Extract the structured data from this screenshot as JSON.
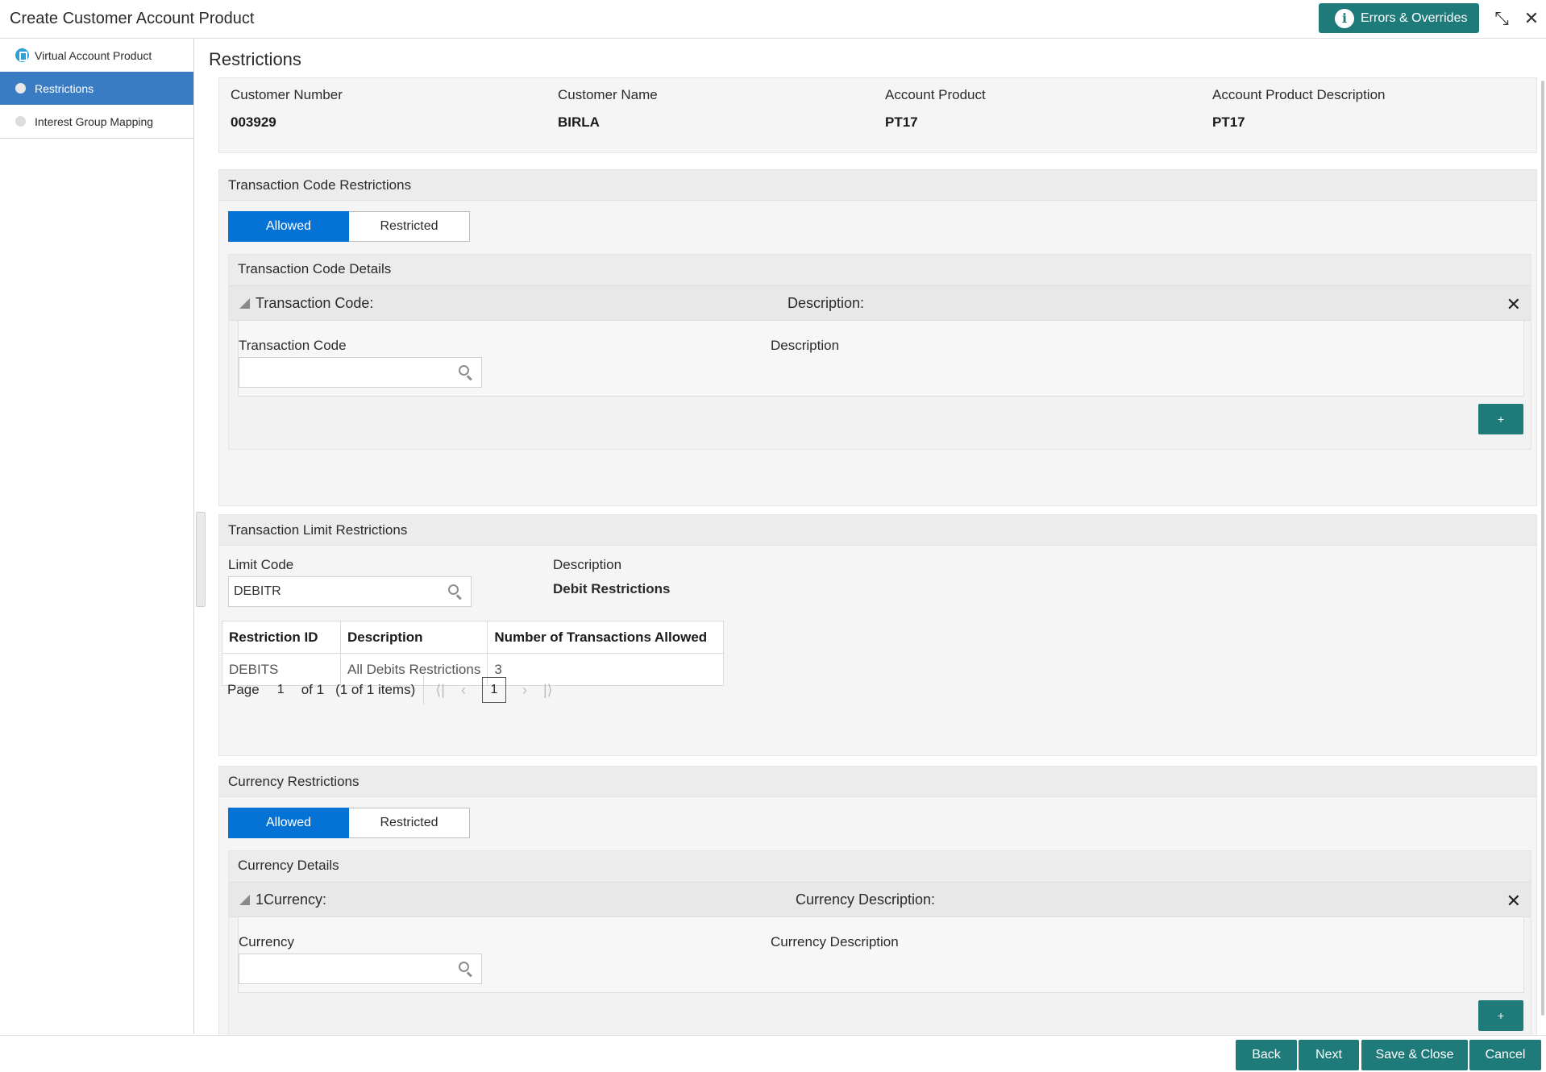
{
  "window": {
    "title": "Create Customer Account Product",
    "errors_label": "Errors & Overrides",
    "info_icon": "i",
    "minimize_icon": "⤡",
    "close_icon": "✕"
  },
  "sidebar": {
    "items": [
      {
        "label": "Virtual Account Product",
        "state": "completed"
      },
      {
        "label": "Restrictions",
        "state": "active"
      },
      {
        "label": "Interest Group Mapping",
        "state": "pending"
      }
    ]
  },
  "page": {
    "title": "Restrictions"
  },
  "summary": {
    "customer_number_label": "Customer Number",
    "customer_number": "003929",
    "customer_name_label": "Customer Name",
    "customer_name": "BIRLA",
    "account_product_label": "Account Product",
    "account_product": "PT17",
    "account_product_desc_label": "Account Product Description",
    "account_product_desc": "PT17"
  },
  "txn_code": {
    "section_title": "Transaction Code Restrictions",
    "allowed_label": "Allowed",
    "restricted_label": "Restricted",
    "selected": "Allowed",
    "details_title": "Transaction Code Details",
    "row_code_label": "Transaction Code:",
    "row_desc_label": "Description:",
    "field_code_label": "Transaction Code",
    "field_code_value": "",
    "field_desc_label": "Description",
    "add_label": "+",
    "remove_icon": "✕"
  },
  "txn_limit": {
    "section_title": "Transaction Limit Restrictions",
    "limit_code_label": "Limit Code",
    "limit_code_value": "DEBITR",
    "description_label": "Description",
    "description_value": "Debit Restrictions",
    "grid": {
      "headers": [
        "Restriction ID",
        "Description",
        "Number of Transactions Allowed"
      ],
      "rows": [
        [
          "DEBITS",
          "All Debits Restrictions",
          "3"
        ]
      ]
    },
    "pager": {
      "page_label": "Page",
      "page_value": "1",
      "of_label": "of 1",
      "items_label": "(1 of 1 items)",
      "current": "1",
      "first_icon": "⟨|",
      "prev_icon": "‹",
      "next_icon": "›",
      "last_icon": "|⟩"
    }
  },
  "currency": {
    "section_title": "Currency Restrictions",
    "allowed_label": "Allowed",
    "restricted_label": "Restricted",
    "selected": "Allowed",
    "details_title": "Currency Details",
    "row_code_label": "1Currency:",
    "row_desc_label": "Currency Description:",
    "field_code_label": "Currency",
    "field_code_value": "",
    "field_desc_label": "Currency Description",
    "add_label": "+",
    "remove_icon": "✕"
  },
  "footer": {
    "back_label": "Back",
    "next_label": "Next",
    "save_close_label": "Save & Close",
    "cancel_label": "Cancel"
  },
  "colors": {
    "accent_teal": "#1f7a7a",
    "toggle_blue": "#0573d6",
    "sidebar_active": "#3a7cc3",
    "step_done": "#2f9fd6"
  }
}
